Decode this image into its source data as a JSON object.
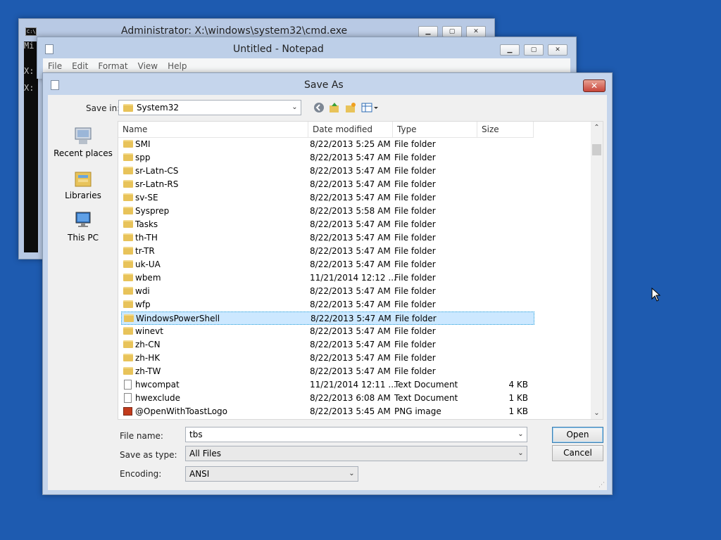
{
  "cmd": {
    "title": "Administrator: X:\\windows\\system32\\cmd.exe",
    "icon_text": "C:\\",
    "console_lines": [
      "Mi",
      "",
      "",
      "X:",
      "",
      "X:"
    ]
  },
  "notepad": {
    "title": "Untitled - Notepad",
    "menu": [
      "File",
      "Edit",
      "Format",
      "View",
      "Help"
    ]
  },
  "saveas": {
    "title": "Save As",
    "close_glyph": "✕",
    "save_in_label": "Save in:",
    "save_in_value": "System32",
    "places": [
      "Recent places",
      "Libraries",
      "This PC"
    ],
    "columns": [
      "Name",
      "Date modified",
      "Type",
      "Size"
    ],
    "rows": [
      {
        "name": "SMI",
        "date": "8/22/2013 5:25 AM",
        "type": "File folder",
        "size": "",
        "icon": "folder"
      },
      {
        "name": "spp",
        "date": "8/22/2013 5:47 AM",
        "type": "File folder",
        "size": "",
        "icon": "folder"
      },
      {
        "name": "sr-Latn-CS",
        "date": "8/22/2013 5:47 AM",
        "type": "File folder",
        "size": "",
        "icon": "folder"
      },
      {
        "name": "sr-Latn-RS",
        "date": "8/22/2013 5:47 AM",
        "type": "File folder",
        "size": "",
        "icon": "folder"
      },
      {
        "name": "sv-SE",
        "date": "8/22/2013 5:47 AM",
        "type": "File folder",
        "size": "",
        "icon": "folder"
      },
      {
        "name": "Sysprep",
        "date": "8/22/2013 5:58 AM",
        "type": "File folder",
        "size": "",
        "icon": "folder"
      },
      {
        "name": "Tasks",
        "date": "8/22/2013 5:47 AM",
        "type": "File folder",
        "size": "",
        "icon": "folder"
      },
      {
        "name": "th-TH",
        "date": "8/22/2013 5:47 AM",
        "type": "File folder",
        "size": "",
        "icon": "folder"
      },
      {
        "name": "tr-TR",
        "date": "8/22/2013 5:47 AM",
        "type": "File folder",
        "size": "",
        "icon": "folder"
      },
      {
        "name": "uk-UA",
        "date": "8/22/2013 5:47 AM",
        "type": "File folder",
        "size": "",
        "icon": "folder"
      },
      {
        "name": "wbem",
        "date": "11/21/2014 12:12 ...",
        "type": "File folder",
        "size": "",
        "icon": "folder"
      },
      {
        "name": "wdi",
        "date": "8/22/2013 5:47 AM",
        "type": "File folder",
        "size": "",
        "icon": "folder"
      },
      {
        "name": "wfp",
        "date": "8/22/2013 5:47 AM",
        "type": "File folder",
        "size": "",
        "icon": "folder"
      },
      {
        "name": "WindowsPowerShell",
        "date": "8/22/2013 5:47 AM",
        "type": "File folder",
        "size": "",
        "icon": "folder",
        "selected": true
      },
      {
        "name": "winevt",
        "date": "8/22/2013 5:47 AM",
        "type": "File folder",
        "size": "",
        "icon": "folder"
      },
      {
        "name": "zh-CN",
        "date": "8/22/2013 5:47 AM",
        "type": "File folder",
        "size": "",
        "icon": "folder"
      },
      {
        "name": "zh-HK",
        "date": "8/22/2013 5:47 AM",
        "type": "File folder",
        "size": "",
        "icon": "folder"
      },
      {
        "name": "zh-TW",
        "date": "8/22/2013 5:47 AM",
        "type": "File folder",
        "size": "",
        "icon": "folder"
      },
      {
        "name": "hwcompat",
        "date": "11/21/2014 12:11 ...",
        "type": "Text Document",
        "size": "4 KB",
        "icon": "doc"
      },
      {
        "name": "hwexclude",
        "date": "8/22/2013 6:08 AM",
        "type": "Text Document",
        "size": "1 KB",
        "icon": "doc"
      },
      {
        "name": "@OpenWithToastLogo",
        "date": "8/22/2013 5:45 AM",
        "type": "PNG image",
        "size": "1 KB",
        "icon": "png"
      }
    ],
    "file_name_label": "File name:",
    "file_name_value": "tbs",
    "save_type_label": "Save as type:",
    "save_type_value": "All Files",
    "encoding_label": "Encoding:",
    "encoding_value": "ANSI",
    "open_label": "Open",
    "cancel_label": "Cancel"
  },
  "colors": {
    "desktop": "#1e5bb0",
    "selection": "#cce8ff",
    "close": "#c8453a"
  }
}
